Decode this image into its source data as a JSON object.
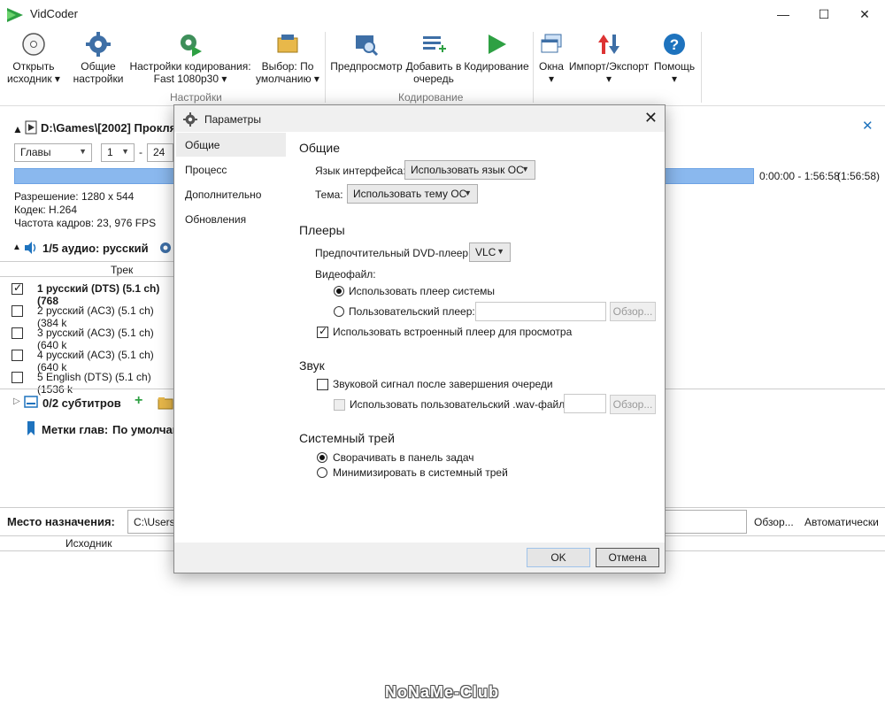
{
  "window": {
    "title": "VidCoder",
    "minimize": "—",
    "maximize": "☐",
    "close": "✕"
  },
  "ribbon": {
    "open_source": "Открыть источник ▾",
    "general_settings": "Общие настройки",
    "encoding_settings": "Настройки кодирования: Fast 1080p30 ▾",
    "pick_default": "Выбор: По умолчанию ▾",
    "group_settings": "Настройки",
    "preview": "Предпросмотр",
    "add_to_queue": "Добавить в очередь",
    "encode": "Кодирование",
    "group_encoding": "Кодирование",
    "windows": "Окна ▾",
    "import_export": "Импорт/Экспорт ▾",
    "help": "Помощь ▾",
    "open_source_l1": "Открыть",
    "open_source_l2": "исходник ▾",
    "general_l1": "Общие",
    "general_l2": "настройки",
    "enc_l1": "Настройки кодирования:",
    "enc_l2": "Fast 1080p30 ▾",
    "pick_l1": "Выбор: По",
    "pick_l2": "умолчанию ▾",
    "add_l1": "Добавить в",
    "add_l2": "очередь",
    "windows_l1": "Окна",
    "windows_l2": "▾",
    "ie_l1": "Импорт/Экспорт",
    "ie_l2": "▾",
    "help_l1": "Помощь",
    "help_l2": "▾"
  },
  "source": {
    "path": "D:\\Games\\[2002] Прокля",
    "close": "✕",
    "range_type": "Главы",
    "range_from": "1",
    "range_dash": "-",
    "range_to": "24",
    "time_range": "0:00:00 - 1:56:58",
    "duration": "(1:56:58)",
    "resolution": "Разрешение: 1280 x 544",
    "codec": "Кодек: H.264",
    "framerate": "Частота кадров: 23, 976 FPS"
  },
  "audio": {
    "header": "1/5 аудио: русский",
    "col_track": "Трек",
    "tracks": [
      {
        "label": "1 русский (DTS) (5.1 ch) (768",
        "checked": true
      },
      {
        "label": "2 русский (AC3) (5.1 ch) (384 k",
        "checked": false
      },
      {
        "label": "3 русский (AC3) (5.1 ch) (640 k",
        "checked": false
      },
      {
        "label": "4 русский (AC3) (5.1 ch) (640 k",
        "checked": false
      },
      {
        "label": "5 English (DTS) (5.1 ch) (1536 k",
        "checked": false
      }
    ]
  },
  "subtitles": {
    "header": "0/2 субтитров",
    "add": "+"
  },
  "chapters": {
    "label": "Метки глав:",
    "value": "По умолчан"
  },
  "destination": {
    "label": "Место назначения:",
    "path": "C:\\Users\\",
    "browse": "Обзор...",
    "auto": "Автоматически",
    "col_source": "Исходник"
  },
  "dialog": {
    "title": "Параметры",
    "close": "✕",
    "nav": [
      "Общие",
      "Процесс",
      "Дополнительно",
      "Обновления"
    ],
    "general": {
      "title": "Общие",
      "lang_label": "Язык интерфейса:",
      "lang_value": "Использовать язык ОС",
      "theme_label": "Тема:",
      "theme_value": "Использовать тему ОС"
    },
    "players": {
      "title": "Плееры",
      "dvd_label": "Предпочтительный DVD-плеер:",
      "dvd_value": "VLC",
      "video_label": "Видеофайл:",
      "system_player": "Использовать плеер системы",
      "custom_player": "Пользовательский плеер:",
      "browse": "Обзор...",
      "builtin_player": "Использовать встроенный плеер для просмотра"
    },
    "sound": {
      "title": "Звук",
      "beep": "Звуковой сигнал после завершения очереди",
      "custom_wav": "Использовать пользовательский .wav-файл:",
      "browse": "Обзор..."
    },
    "tray": {
      "title": "Системный трей",
      "minimize_taskbar": "Сворачивать в панель задач",
      "minimize_tray": "Минимизировать в системный трей"
    },
    "ok": "OK",
    "cancel": "Отмена"
  },
  "watermark": "NoNaMe-Club",
  "colors": {
    "accent_blue": "#1e73be",
    "progress": "#8ab8ee",
    "green": "#2ea043",
    "red": "#d33"
  }
}
